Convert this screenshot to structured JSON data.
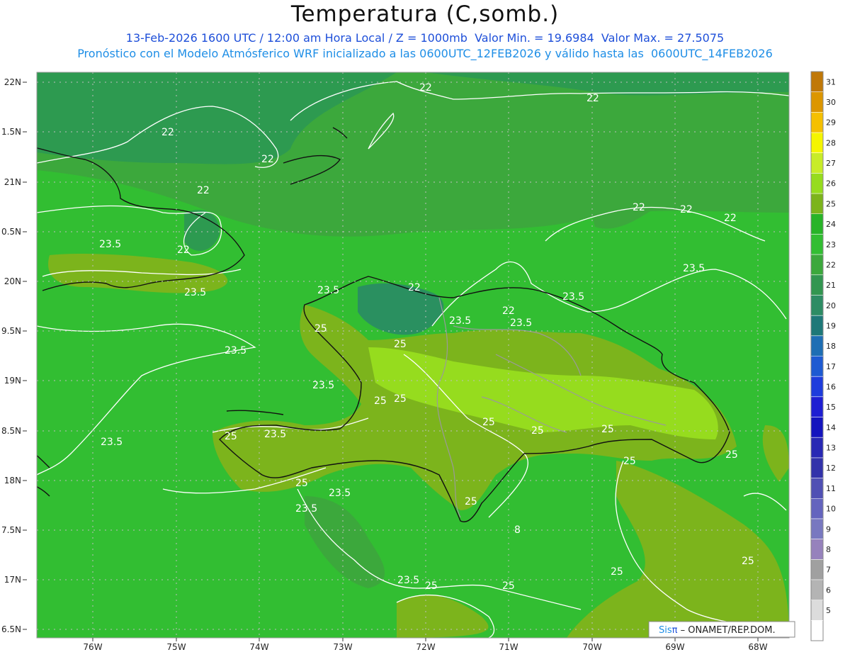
{
  "header": {
    "title": "Temperatura (C,somb.)",
    "line1": "13-Feb-2026 1600 UTC / 12:00 am Hora Local / Z = 1000mb  Valor Min. = 19.6984  Valor Max. = 27.5075",
    "line2": "Pronóstico con el Modelo Atmósferico WRF inicializado a las 0600UTC_12FEB2026 y válido hasta las  0600UTC_14FEB2026"
  },
  "axes": {
    "lat_labels": [
      "22N",
      "1.5N",
      "21N",
      "0.5N",
      "20N",
      "9.5N",
      "19N",
      "8.5N",
      "18N",
      "7.5N",
      "17N",
      "6.5N"
    ],
    "lon_labels": [
      "76W",
      "75W",
      "74W",
      "73W",
      "72W",
      "71W",
      "70W",
      "69W",
      "68W"
    ]
  },
  "contour_labels": {
    "l22": "22",
    "l235": "23.5",
    "l25": "25",
    "l8": "8"
  },
  "colorbar": {
    "labels": [
      "31",
      "30",
      "29",
      "28",
      "27",
      "26",
      "25",
      "24",
      "23",
      "22",
      "21",
      "20",
      "19",
      "18",
      "17",
      "16",
      "15",
      "14",
      "13",
      "12",
      "11",
      "10",
      "9",
      "8",
      "7",
      "6",
      "5"
    ],
    "colors": [
      "#c07808",
      "#dc9600",
      "#f5c000",
      "#f5f500",
      "#c8ec28",
      "#96dc1e",
      "#7cb41c",
      "#28b428",
      "#32be32",
      "#3ca83c",
      "#329650",
      "#2d8c64",
      "#1e7878",
      "#1e6eb4",
      "#1e5ad2",
      "#1e3cdc",
      "#1e1ed2",
      "#1414be",
      "#2828b4",
      "#3232aa",
      "#5050b4",
      "#6464be",
      "#7878c0",
      "#9682bc",
      "#a0a0a0",
      "#b4b4b4",
      "#dcdcdc",
      "#ffffff"
    ]
  },
  "credit": {
    "sis": "Sis",
    "pi": "π",
    "rest": " – ONAMET/REP.DOM."
  }
}
